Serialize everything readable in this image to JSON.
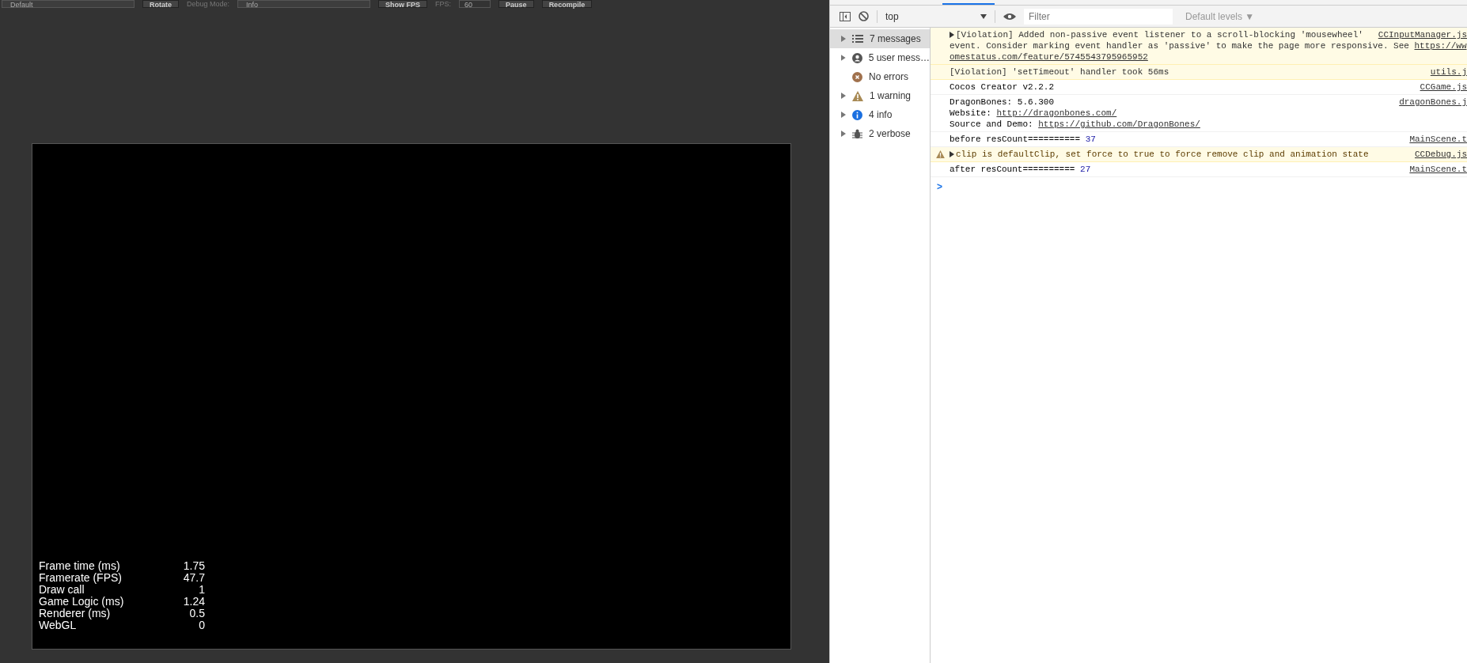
{
  "game_toolbar": [
    {
      "kind": "select",
      "text": "Default"
    },
    {
      "kind": "button",
      "text": "Rotate"
    },
    {
      "kind": "label",
      "text": "Debug Mode:"
    },
    {
      "kind": "select",
      "text": "Info"
    },
    {
      "kind": "button",
      "text": "Show FPS"
    },
    {
      "kind": "label",
      "text": "FPS:"
    },
    {
      "kind": "input",
      "text": "60"
    },
    {
      "kind": "button",
      "text": "Pause"
    },
    {
      "kind": "button",
      "text": "Recompile"
    }
  ],
  "stats": [
    {
      "label": "Frame time (ms)",
      "value": "1.75"
    },
    {
      "label": "Framerate (FPS)",
      "value": "47.7"
    },
    {
      "label": "Draw call",
      "value": "1"
    },
    {
      "label": "Game Logic (ms)",
      "value": "1.24"
    },
    {
      "label": "Renderer (ms)",
      "value": "0.5"
    },
    {
      "label": "WebGL",
      "value": "0"
    }
  ],
  "console_toolbar": {
    "context": "top",
    "filter_placeholder": "Filter",
    "levels": "Default levels ▼"
  },
  "sidebar": [
    {
      "kind": "messages",
      "label": "7 messages",
      "expandable": true,
      "selected": true
    },
    {
      "kind": "user",
      "label": "5 user mess…",
      "expandable": true,
      "selected": false
    },
    {
      "kind": "error",
      "label": "No errors",
      "expandable": false,
      "selected": false
    },
    {
      "kind": "warning",
      "label": "1 warning",
      "expandable": true,
      "selected": false
    },
    {
      "kind": "info",
      "label": "4 info",
      "expandable": true,
      "selected": false
    },
    {
      "kind": "verbose",
      "label": "2 verbose",
      "expandable": true,
      "selected": false
    }
  ],
  "messages": [
    {
      "kind": "violation",
      "expandable": true,
      "source": "CCInputManager.js",
      "lines": [
        [
          {
            "kind": "text",
            "text": "[Violation] Added non-passive event listener to a scroll-blocking 'mousewheel'"
          }
        ],
        [
          {
            "kind": "text",
            "text": "event. Consider marking event handler as 'passive' to make the page more responsive. See "
          },
          {
            "kind": "link",
            "text": "https://ww"
          }
        ],
        [
          {
            "kind": "link",
            "text": "omestatus.com/feature/5745543795965952"
          }
        ]
      ]
    },
    {
      "kind": "violation",
      "expandable": false,
      "source": "utils.j",
      "lines": [
        [
          {
            "kind": "text",
            "text": "[Violation] 'setTimeout' handler took 56ms"
          }
        ]
      ]
    },
    {
      "kind": "log",
      "expandable": false,
      "source": "CCGame.js",
      "lines": [
        [
          {
            "kind": "text",
            "text": "Cocos Creator v2.2.2"
          }
        ]
      ]
    },
    {
      "kind": "log",
      "expandable": false,
      "source": "dragonBones.j",
      "lines": [
        [
          {
            "kind": "text",
            "text": "DragonBones: 5.6.300"
          }
        ],
        [
          {
            "kind": "text",
            "text": "Website: "
          },
          {
            "kind": "link",
            "text": "http://dragonbones.com/"
          }
        ],
        [
          {
            "kind": "text",
            "text": "Source and Demo: "
          },
          {
            "kind": "link",
            "text": "https://github.com/DragonBones/"
          }
        ]
      ]
    },
    {
      "kind": "log",
      "expandable": false,
      "source": "MainScene.t",
      "lines": [
        [
          {
            "kind": "text",
            "text": "before resCount========== "
          },
          {
            "kind": "number",
            "text": "37"
          }
        ]
      ]
    },
    {
      "kind": "warning",
      "expandable": true,
      "source": "CCDebug.js",
      "lines": [
        [
          {
            "kind": "text",
            "text": "clip is defaultClip, set force to true to force remove clip and animation state"
          }
        ]
      ]
    },
    {
      "kind": "log",
      "expandable": false,
      "source": "MainScene.t",
      "lines": [
        [
          {
            "kind": "text",
            "text": "after resCount========== "
          },
          {
            "kind": "number",
            "text": "27"
          }
        ]
      ]
    }
  ],
  "prompt": ">"
}
